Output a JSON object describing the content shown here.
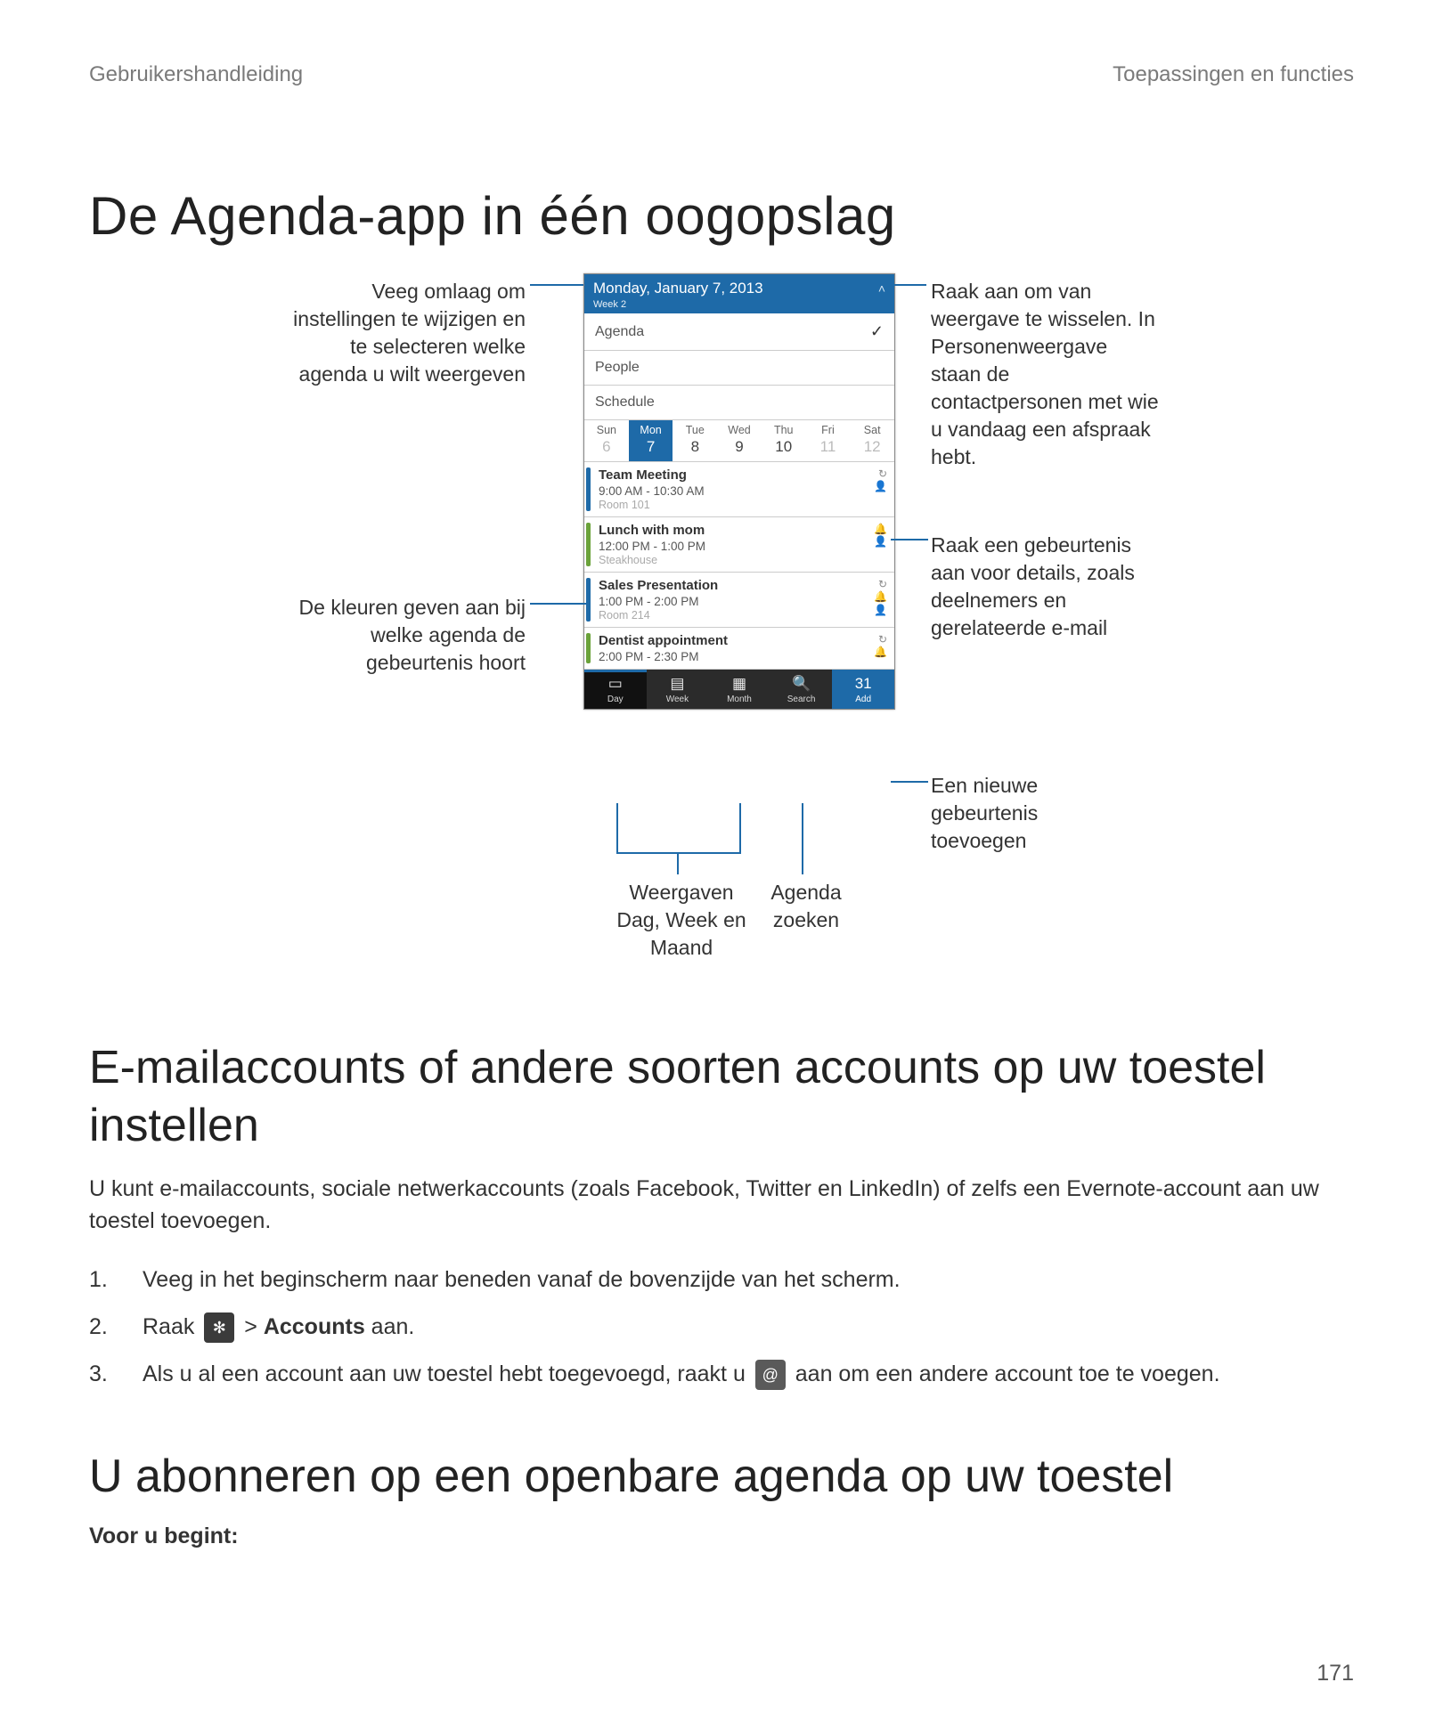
{
  "header": {
    "left": "Gebruikershandleiding",
    "right": "Toepassingen en functies"
  },
  "h1": "De Agenda-app in één oogopslag",
  "h2a": "E-mailaccounts of andere soorten accounts op uw toestel instellen",
  "h2b": "U abonneren op een openbare agenda op uw toestel",
  "intro": "U kunt e-mailaccounts, sociale netwerkaccounts (zoals Facebook, Twitter en LinkedIn) of zelfs een Evernote-account aan uw toestel toevoegen.",
  "steps": {
    "n1": "1.",
    "t1": "Veeg in het beginscherm naar beneden vanaf de bovenzijde van het scherm.",
    "n2": "2.",
    "t2a": "Raak ",
    "t2b": " > ",
    "t2c": "Accounts",
    "t2d": " aan.",
    "n3": "3.",
    "t3a": "Als u al een account aan uw toestel hebt toegevoegd, raakt u ",
    "t3b": " aan om een andere account toe te voegen."
  },
  "before": "Voor u begint:",
  "pagenum": "171",
  "callouts": {
    "c1": "Veeg omlaag om instellingen te wijzigen en te selecteren welke agenda u wilt weergeven",
    "c2": "De kleuren geven aan bij welke agenda de gebeurtenis hoort",
    "c3": "Raak aan om van weergave te wisselen. In Personenweergave staan de contactpersonen met wie u vandaag een afspraak hebt.",
    "c4": "Raak een gebeurtenis aan voor details, zoals deelnemers en gerelateerde e-mail",
    "c5": "Een nieuwe gebeurtenis toevoegen",
    "c6": "Weergaven Dag, Week en Maand",
    "c7": "Agenda zoeken"
  },
  "phone": {
    "title": "Monday, January 7, 2013",
    "week": "Week 2",
    "menu": {
      "agenda": "Agenda",
      "people": "People",
      "schedule": "Schedule"
    },
    "days": [
      {
        "d": "Sun",
        "n": "6",
        "cls": "dim"
      },
      {
        "d": "Mon",
        "n": "7",
        "cls": "sel"
      },
      {
        "d": "Tue",
        "n": "8",
        "cls": ""
      },
      {
        "d": "Wed",
        "n": "9",
        "cls": ""
      },
      {
        "d": "Thu",
        "n": "10",
        "cls": ""
      },
      {
        "d": "Fri",
        "n": "11",
        "cls": "dim"
      },
      {
        "d": "Sat",
        "n": "12",
        "cls": "dim"
      }
    ],
    "events": [
      {
        "title": "Team Meeting",
        "time": "9:00 AM - 10:30 AM",
        "loc": "Room 101",
        "color": "#1e6aa8",
        "icons": "↻\n👤"
      },
      {
        "title": "Lunch with mom",
        "time": "12:00 PM - 1:00 PM",
        "loc": "Steakhouse",
        "color": "#6aa23a",
        "icons": "🔔\n👤"
      },
      {
        "title": "Sales Presentation",
        "time": "1:00 PM - 2:00 PM",
        "loc": "Room 214",
        "color": "#1e6aa8",
        "icons": "↻\n🔔\n👤"
      },
      {
        "title": "Dentist appointment",
        "time": "2:00 PM - 2:30 PM",
        "loc": "",
        "color": "#6aa23a",
        "icons": "↻\n🔔"
      }
    ],
    "tabs": [
      {
        "label": "Day",
        "icon": "▭",
        "cls": "sel"
      },
      {
        "label": "Week",
        "icon": "▤",
        "cls": ""
      },
      {
        "label": "Month",
        "icon": "▦",
        "cls": ""
      },
      {
        "label": "Search",
        "icon": "🔍",
        "cls": ""
      },
      {
        "label": "Add",
        "icon": "31",
        "cls": "add"
      }
    ]
  }
}
